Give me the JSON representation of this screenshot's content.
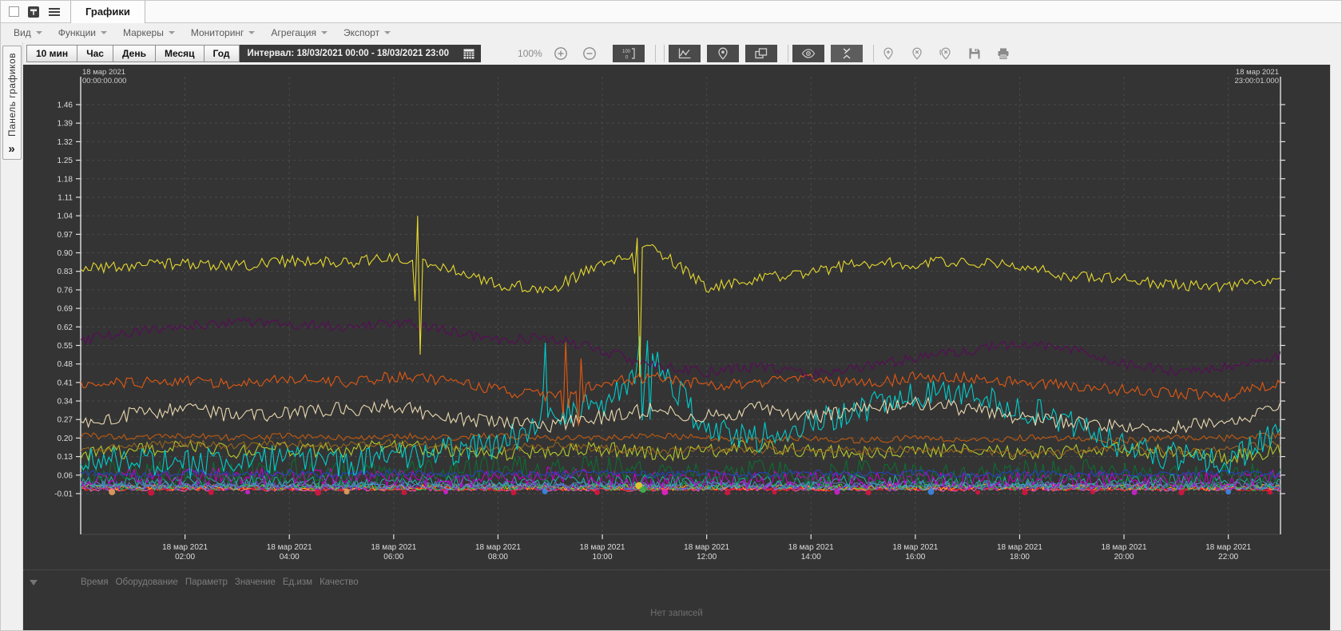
{
  "window": {
    "tab_title": "Графики"
  },
  "menubar": {
    "items": [
      {
        "label": "Вид"
      },
      {
        "label": "Функции"
      },
      {
        "label": "Маркеры"
      },
      {
        "label": "Мониторинг"
      },
      {
        "label": "Агрегация"
      },
      {
        "label": "Экспорт"
      }
    ]
  },
  "toolbar": {
    "range_buttons": [
      "10 мин",
      "Час",
      "День",
      "Месяц",
      "Год"
    ],
    "interval_label": "Интервал: 18/03/2021 00:00 - 18/03/2021 23:00",
    "zoom_level": "100%"
  },
  "side_panel": {
    "label": "Панель графиков",
    "chevron": "»"
  },
  "chart": {
    "top_left_date": "18 мар 2021",
    "top_left_time": "00:00:00.000",
    "top_right_date": "18 мар 2021",
    "top_right_time": "23:00:01.000",
    "background": "#343434",
    "grid_color": "#4a4a4a",
    "axis_color": "#e2e2e2",
    "tick_text_color": "#dedede"
  },
  "chart_data": {
    "type": "line",
    "x_unit": "hours",
    "x_range": [
      0,
      23
    ],
    "ylim": [
      -0.165,
      1.565
    ],
    "y_ticks": [
      1.46,
      1.39,
      1.32,
      1.25,
      1.18,
      1.11,
      1.04,
      0.97,
      0.9,
      0.83,
      0.76,
      0.69,
      0.62,
      0.55,
      0.48,
      0.41,
      0.34,
      0.27,
      0.2,
      0.13,
      0.06,
      -0.01
    ],
    "x_ticks": [
      {
        "hour": 2,
        "date": "18 мар 2021",
        "time": "02:00"
      },
      {
        "hour": 4,
        "date": "18 мар 2021",
        "time": "04:00"
      },
      {
        "hour": 6,
        "date": "18 мар 2021",
        "time": "06:00"
      },
      {
        "hour": 8,
        "date": "18 мар 2021",
        "time": "08:00"
      },
      {
        "hour": 10,
        "date": "18 мар 2021",
        "time": "10:00"
      },
      {
        "hour": 12,
        "date": "18 мар 2021",
        "time": "12:00"
      },
      {
        "hour": 14,
        "date": "18 мар 2021",
        "time": "14:00"
      },
      {
        "hour": 16,
        "date": "18 мар 2021",
        "time": "16:00"
      },
      {
        "hour": 18,
        "date": "18 мар 2021",
        "time": "18:00"
      },
      {
        "hour": 20,
        "date": "18 мар 2021",
        "time": "20:00"
      },
      {
        "hour": 22,
        "date": "18 мар 2021",
        "time": "22:00"
      }
    ],
    "grid": true,
    "legend": "none",
    "series": [
      {
        "name": "series-pink",
        "color": "#ff5ab4",
        "noise": 0.007,
        "values": [
          0.006,
          0.006,
          0.006,
          0.006,
          0.006,
          0.006,
          0.006,
          0.006,
          0.006,
          0.006,
          0.006,
          0.006,
          0.006,
          0.006,
          0.006,
          0.006,
          0.006,
          0.006,
          0.006,
          0.006,
          0.006,
          0.006,
          0.006,
          0.006
        ]
      },
      {
        "name": "series-red",
        "color": "#ff2a1a",
        "noise": 0.008,
        "values": [
          0.008,
          0.008,
          0.008,
          0.008,
          0.008,
          0.008,
          0.008,
          0.008,
          0.008,
          0.008,
          0.008,
          0.008,
          0.008,
          0.008,
          0.008,
          0.008,
          0.008,
          0.008,
          0.008,
          0.008,
          0.008,
          0.008,
          0.008,
          0.008
        ]
      },
      {
        "name": "series-crimson",
        "color": "#e01244",
        "noise": 0.01,
        "values": [
          0.012,
          0.012,
          0.012,
          0.012,
          0.012,
          0.012,
          0.012,
          0.012,
          0.012,
          0.012,
          0.012,
          0.012,
          0.012,
          0.012,
          0.012,
          0.012,
          0.012,
          0.012,
          0.012,
          0.012,
          0.012,
          0.012,
          0.012,
          0.012
        ]
      },
      {
        "name": "series-orange-2",
        "color": "#ffaa22",
        "noise": 0.012,
        "values": [
          0.014,
          0.014,
          0.014,
          0.014,
          0.014,
          0.014,
          0.014,
          0.014,
          0.014,
          0.014,
          0.014,
          0.014,
          0.014,
          0.014,
          0.014,
          0.014,
          0.014,
          0.014,
          0.014,
          0.014,
          0.014,
          0.014,
          0.014,
          0.014
        ]
      },
      {
        "name": "series-light-blue",
        "color": "#4aa2ff",
        "noise": 0.012,
        "values": [
          0.016,
          0.016,
          0.016,
          0.016,
          0.016,
          0.016,
          0.016,
          0.016,
          0.016,
          0.016,
          0.016,
          0.016,
          0.016,
          0.016,
          0.016,
          0.016,
          0.016,
          0.016,
          0.016,
          0.016,
          0.016,
          0.016,
          0.016,
          0.016
        ]
      },
      {
        "name": "series-green-2",
        "color": "#2ab84a",
        "noise": 0.014,
        "values": [
          0.015,
          0.015,
          0.015,
          0.015,
          0.015,
          0.015,
          0.015,
          0.015,
          0.015,
          0.015,
          0.015,
          0.015,
          0.015,
          0.015,
          0.015,
          0.015,
          0.015,
          0.015,
          0.015,
          0.015,
          0.015,
          0.015,
          0.015,
          0.015
        ]
      },
      {
        "name": "series-violet",
        "color": "#7a3ad0",
        "noise": 0.018,
        "values": [
          0.02,
          0.02,
          0.02,
          0.02,
          0.02,
          0.02,
          0.02,
          0.02,
          0.02,
          0.02,
          0.02,
          0.02,
          0.02,
          0.02,
          0.02,
          0.02,
          0.02,
          0.02,
          0.02,
          0.02,
          0.02,
          0.02,
          0.02,
          0.02
        ]
      },
      {
        "name": "series-slate",
        "color": "#5a7ab4",
        "noise": 0.012,
        "values": [
          0.025,
          0.025,
          0.025,
          0.025,
          0.025,
          0.025,
          0.025,
          0.025,
          0.025,
          0.025,
          0.025,
          0.025,
          0.025,
          0.025,
          0.025,
          0.025,
          0.025,
          0.025,
          0.025,
          0.025,
          0.025,
          0.025,
          0.025,
          0.025
        ]
      },
      {
        "name": "series-teal",
        "color": "#20b0a0",
        "noise": 0.025,
        "values": [
          0.03,
          0.04,
          0.03,
          0.04,
          0.03,
          0.04,
          0.03,
          0.04,
          0.03,
          0.04,
          0.03,
          0.04,
          0.03,
          0.04,
          0.03,
          0.04,
          0.03,
          0.04,
          0.03,
          0.04,
          0.03,
          0.04,
          0.03,
          0.03
        ]
      },
      {
        "name": "series-magenta",
        "color": "#cc00cc",
        "noise": 0.032,
        "values": [
          0.05,
          0.06,
          0.05,
          0.06,
          0.05,
          0.06,
          0.05,
          0.04,
          0.05,
          0.06,
          0.05,
          0.04,
          0.05,
          0.04,
          0.05,
          0.04,
          0.05,
          0.04,
          0.05,
          0.04,
          0.05,
          0.04,
          0.05,
          0.05
        ]
      },
      {
        "name": "series-dark-green",
        "color": "#0c6e32",
        "noise": 0.045,
        "values": [
          0.06,
          0.08,
          0.06,
          0.07,
          0.08,
          0.06,
          0.08,
          0.07,
          0.09,
          0.08,
          0.09,
          0.08,
          0.06,
          0.08,
          0.06,
          0.08,
          0.06,
          0.05,
          0.07,
          0.08,
          0.06,
          0.05,
          0.06,
          0.07
        ]
      },
      {
        "name": "series-blue",
        "color": "#2840c0",
        "noise": 0.012,
        "values": [
          0.07,
          0.06,
          0.07,
          0.06,
          0.07,
          0.06,
          0.07,
          0.06,
          0.07,
          0.06,
          0.07,
          0.06,
          0.07,
          0.06,
          0.07,
          0.06,
          0.07,
          0.06,
          0.07,
          0.06,
          0.07,
          0.06,
          0.07,
          0.06
        ]
      },
      {
        "name": "series-olive",
        "color": "#b4c82a",
        "noise": 0.028,
        "values": [
          0.14,
          0.15,
          0.17,
          0.15,
          0.16,
          0.15,
          0.17,
          0.16,
          0.14,
          0.15,
          0.16,
          0.14,
          0.15,
          0.17,
          0.15,
          0.14,
          0.15,
          0.16,
          0.14,
          0.15,
          0.16,
          0.14,
          0.13,
          0.15
        ]
      },
      {
        "name": "series-brown",
        "color": "#96641e",
        "noise": 0.015,
        "values": [
          0.16,
          0.17,
          0.18,
          0.17,
          0.18,
          0.17,
          0.18,
          0.17,
          0.16,
          0.17,
          0.16,
          0.15,
          0.16,
          0.15,
          0.16,
          0.15,
          0.16,
          0.15,
          0.14,
          0.15,
          0.16,
          0.15,
          0.16,
          0.18
        ]
      },
      {
        "name": "series-dark-orange",
        "color": "#c05a10",
        "noise": 0.012,
        "values": [
          0.21,
          0.2,
          0.21,
          0.2,
          0.21,
          0.2,
          0.21,
          0.2,
          0.21,
          0.2,
          0.2,
          0.21,
          0.2,
          0.19,
          0.2,
          0.19,
          0.2,
          0.19,
          0.2,
          0.2,
          0.19,
          0.2,
          0.2,
          0.21
        ]
      },
      {
        "name": "series-cyan",
        "color": "#00cccc",
        "noise": 0.055,
        "spikes": [
          {
            "t": 8.9,
            "v": 0.55
          },
          {
            "t": 10.7,
            "v": 0.62
          },
          {
            "t": 10.85,
            "v": 0.55
          }
        ],
        "values": [
          0.11,
          0.12,
          0.1,
          0.12,
          0.12,
          0.1,
          0.13,
          0.15,
          0.17,
          0.28,
          0.33,
          0.5,
          0.22,
          0.2,
          0.26,
          0.31,
          0.36,
          0.38,
          0.31,
          0.26,
          0.16,
          0.13,
          0.11,
          0.22
        ]
      },
      {
        "name": "series-wheat",
        "color": "#ead9b0",
        "noise": 0.028,
        "values": [
          0.26,
          0.29,
          0.31,
          0.28,
          0.3,
          0.31,
          0.32,
          0.28,
          0.26,
          0.25,
          0.28,
          0.31,
          0.28,
          0.31,
          0.28,
          0.31,
          0.33,
          0.31,
          0.28,
          0.26,
          0.25,
          0.24,
          0.27,
          0.31
        ]
      },
      {
        "name": "series-orange",
        "color": "#e25812",
        "noise": 0.022,
        "spikes": [
          {
            "t": 9.3,
            "v": 0.5
          },
          {
            "t": 9.6,
            "v": 0.47
          }
        ],
        "values": [
          0.4,
          0.41,
          0.42,
          0.4,
          0.43,
          0.41,
          0.43,
          0.42,
          0.38,
          0.36,
          0.41,
          0.43,
          0.4,
          0.41,
          0.43,
          0.4,
          0.43,
          0.43,
          0.41,
          0.4,
          0.38,
          0.37,
          0.36,
          0.41
        ]
      },
      {
        "name": "series-purple",
        "color": "#5a0a5a",
        "noise": 0.02,
        "values": [
          0.57,
          0.6,
          0.62,
          0.64,
          0.63,
          0.62,
          0.64,
          0.61,
          0.57,
          0.58,
          0.53,
          0.47,
          0.45,
          0.47,
          0.44,
          0.47,
          0.5,
          0.53,
          0.56,
          0.54,
          0.48,
          0.45,
          0.47,
          0.51
        ]
      },
      {
        "name": "series-yellow",
        "color": "#e6d92e",
        "noise": 0.022,
        "spikes": [
          {
            "t": 6.45,
            "v": 0.97
          },
          {
            "t": 10.65,
            "v": 0.97
          }
        ],
        "values": [
          0.84,
          0.85,
          0.86,
          0.85,
          0.87,
          0.86,
          0.88,
          0.85,
          0.78,
          0.76,
          0.86,
          0.92,
          0.77,
          0.8,
          0.83,
          0.86,
          0.86,
          0.87,
          0.85,
          0.81,
          0.8,
          0.78,
          0.77,
          0.81
        ]
      }
    ],
    "markers": [
      {
        "t": 0.6,
        "v": -0.004,
        "color": "#e8a060",
        "r": 4
      },
      {
        "t": 1.35,
        "v": -0.006,
        "color": "#d81440",
        "r": 4
      },
      {
        "t": 2.5,
        "v": -0.005,
        "color": "#d81440",
        "r": 3.5
      },
      {
        "t": 3.2,
        "v": -0.004,
        "color": "#cc22cc",
        "r": 3
      },
      {
        "t": 4.55,
        "v": -0.006,
        "color": "#d81440",
        "r": 4
      },
      {
        "t": 5.1,
        "v": -0.003,
        "color": "#e8a060",
        "r": 3.5
      },
      {
        "t": 6.2,
        "v": -0.005,
        "color": "#d81440",
        "r": 3.5
      },
      {
        "t": 7.0,
        "v": -0.004,
        "color": "#cc22cc",
        "r": 3
      },
      {
        "t": 8.3,
        "v": -0.006,
        "color": "#d81440",
        "r": 3.5
      },
      {
        "t": 8.9,
        "v": -0.002,
        "color": "#3a8ae8",
        "r": 3.5
      },
      {
        "t": 9.9,
        "v": -0.005,
        "color": "#d81440",
        "r": 3.5
      },
      {
        "t": 10.7,
        "v": 0.02,
        "color": "#e8d024",
        "r": 4.5
      },
      {
        "t": 10.78,
        "v": 0.005,
        "color": "#3ab84a",
        "r": 4
      },
      {
        "t": 11.2,
        "v": -0.004,
        "color": "#e822c8",
        "r": 4
      },
      {
        "t": 12.4,
        "v": -0.006,
        "color": "#d81440",
        "r": 3.5
      },
      {
        "t": 13.3,
        "v": -0.005,
        "color": "#d81440",
        "r": 3
      },
      {
        "t": 14.5,
        "v": -0.004,
        "color": "#cc22cc",
        "r": 3.5
      },
      {
        "t": 15.1,
        "v": -0.006,
        "color": "#d81440",
        "r": 3.5
      },
      {
        "t": 16.3,
        "v": -0.003,
        "color": "#3a8ae8",
        "r": 4
      },
      {
        "t": 17.2,
        "v": -0.005,
        "color": "#d81440",
        "r": 3
      },
      {
        "t": 18.1,
        "v": -0.006,
        "color": "#d81440",
        "r": 3.5
      },
      {
        "t": 19.4,
        "v": -0.004,
        "color": "#d81440",
        "r": 3
      },
      {
        "t": 20.2,
        "v": -0.005,
        "color": "#cc22cc",
        "r": 3.5
      },
      {
        "t": 21.1,
        "v": -0.006,
        "color": "#d81440",
        "r": 3.5
      },
      {
        "t": 22.0,
        "v": -0.003,
        "color": "#3a8ae8",
        "r": 3.5
      },
      {
        "t": 22.8,
        "v": -0.005,
        "color": "#d81440",
        "r": 3
      }
    ]
  },
  "table": {
    "columns": [
      "Время",
      "Оборудование",
      "Параметр",
      "Значение",
      "Ед.изм",
      "Качество"
    ],
    "empty_text": "Нет записей"
  }
}
